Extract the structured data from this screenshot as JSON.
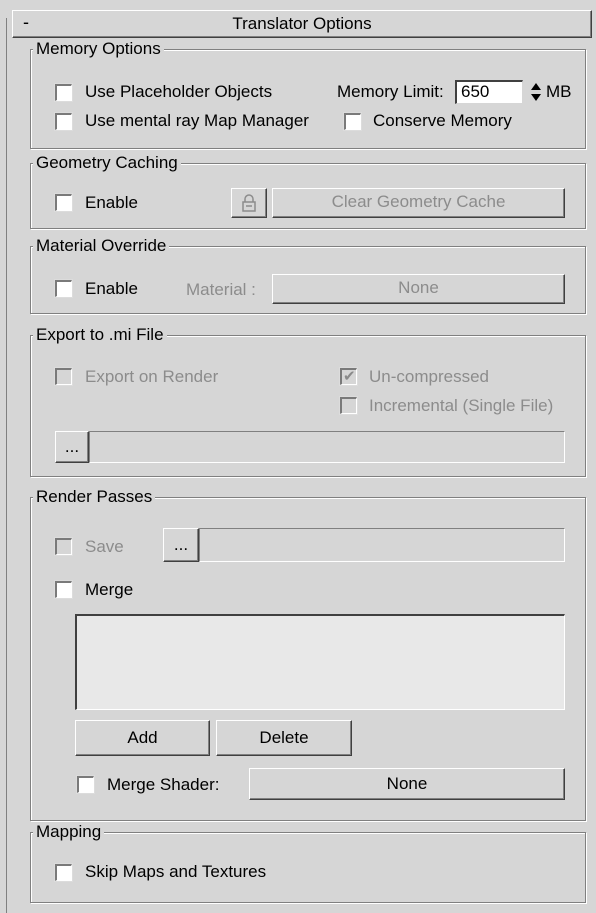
{
  "rollout": {
    "collapse_glyph": "-",
    "title": "Translator Options"
  },
  "memory": {
    "label": "Memory Options",
    "placeholder_objects": "Use Placeholder Objects",
    "memory_limit_label": "Memory Limit:",
    "memory_limit_value": "650",
    "memory_unit": "MB",
    "map_manager": "Use mental ray Map Manager",
    "conserve_memory": "Conserve Memory"
  },
  "geometry": {
    "label": "Geometry Caching",
    "enable": "Enable",
    "clear_button": "Clear Geometry Cache",
    "lock_icon": "lock-icon"
  },
  "material": {
    "label": "Material Override",
    "enable": "Enable",
    "material_label": "Material :",
    "material_value": "None"
  },
  "export": {
    "label": "Export to .mi File",
    "export_on_render": "Export on Render",
    "uncompressed": "Un-compressed",
    "uncompressed_checked": true,
    "incremental": "Incremental (Single File)",
    "browse": "..."
  },
  "passes": {
    "label": "Render Passes",
    "save": "Save",
    "browse": "...",
    "merge": "Merge",
    "add": "Add",
    "delete": "Delete",
    "merge_shader": "Merge Shader:",
    "merge_shader_value": "None"
  },
  "mapping": {
    "label": "Mapping",
    "skip_maps": "Skip Maps and Textures"
  }
}
